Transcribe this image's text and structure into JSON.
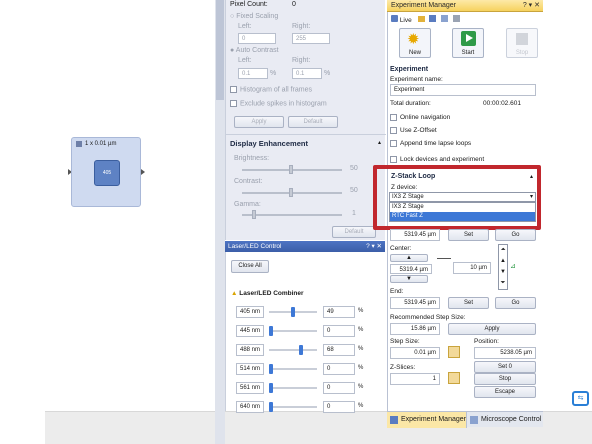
{
  "node": {
    "label": "1 x 0.01 µm",
    "icon_text": "405\nPE-100"
  },
  "image_panel": {
    "pixel_count_label": "Pixel Count:",
    "pixel_count_value": "0",
    "fixed_scaling": "Fixed Scaling",
    "left1_label": "Left:",
    "left1_value": "0",
    "right1_label": "Right:",
    "right1_value": "255",
    "auto_contrast": "Auto Contrast",
    "left2_label": "Left:",
    "left2_value": "0.1",
    "right2_label": "Right:",
    "right2_value": "0.1",
    "pct": "%",
    "histogram_all": "Histogram of all frames",
    "exclude_spikes": "Exclude spikes in histogram",
    "apply": "Apply",
    "default": "Default"
  },
  "display_enhancement": {
    "title": "Display Enhancement",
    "brightness_label": "Brightness:",
    "brightness_value": "50",
    "contrast_label": "Contrast:",
    "contrast_value": "50",
    "gamma_label": "Gamma:",
    "gamma_value": "1",
    "default": "Default"
  },
  "laser": {
    "title": "Laser/LED Control",
    "header_icons": "? ▾ ✕",
    "close_all": "Close All",
    "combiner": "Laser/LED Combiner",
    "pct": "%",
    "rows": [
      {
        "wavelength": "405 nm",
        "value": "49",
        "level": 0.49
      },
      {
        "wavelength": "445 nm",
        "value": "0",
        "level": 0
      },
      {
        "wavelength": "488 nm",
        "value": "68",
        "level": 0.68
      },
      {
        "wavelength": "514 nm",
        "value": "0",
        "level": 0
      },
      {
        "wavelength": "561 nm",
        "value": "0",
        "level": 0
      },
      {
        "wavelength": "640 nm",
        "value": "0",
        "level": 0
      }
    ]
  },
  "experiment_manager": {
    "title": "Experiment Manager",
    "header_icons": "? ▾ ✕",
    "live_label": "Live",
    "new_label": "New",
    "start_label": "Start",
    "stop_label": "Stop",
    "experiment_section": "Experiment",
    "name_label": "Experiment name:",
    "name_value": "Experiment",
    "duration_label": "Total duration:",
    "duration_value": "00:00:02.601",
    "online_navigation": "Online navigation",
    "use_zoffset": "Use Z-Offset",
    "append_loops": "Append time lapse loops",
    "lock_devices": "Lock devices and experiment"
  },
  "zstack": {
    "title": "Z-Stack Loop",
    "zdevice_label": "Z device:",
    "zdevice_selected": "IX3 Z Stage",
    "options": [
      "IX3 Z Stage",
      "RTC Fast Z"
    ],
    "start_value": "5319.45 µm",
    "set": "Set",
    "go": "Go",
    "center_label": "Center:",
    "center_value": "5319.4 µm",
    "range_value": "10 µm",
    "end_label": "End:",
    "end_value": "5319.45 µm",
    "rec_step_label": "Recommended Step Size:",
    "rec_step_value": "15.86 µm",
    "apply": "Apply",
    "step_label": "Step Size:",
    "step_value": "0.01 µm",
    "position_label": "Position:",
    "position_value": "5238.05 µm",
    "zslices_label": "Z-Slices:",
    "zslices_value": "1",
    "set0": "Set 0",
    "stop": "Stop",
    "escape": "Escape"
  },
  "tabs": {
    "experiment_manager": "Experiment Manager",
    "microscope_control": "Microscope Control"
  },
  "colors": {
    "highlight": "#c1272d",
    "selection": "#3d78d6",
    "header": "#f6d25e"
  }
}
